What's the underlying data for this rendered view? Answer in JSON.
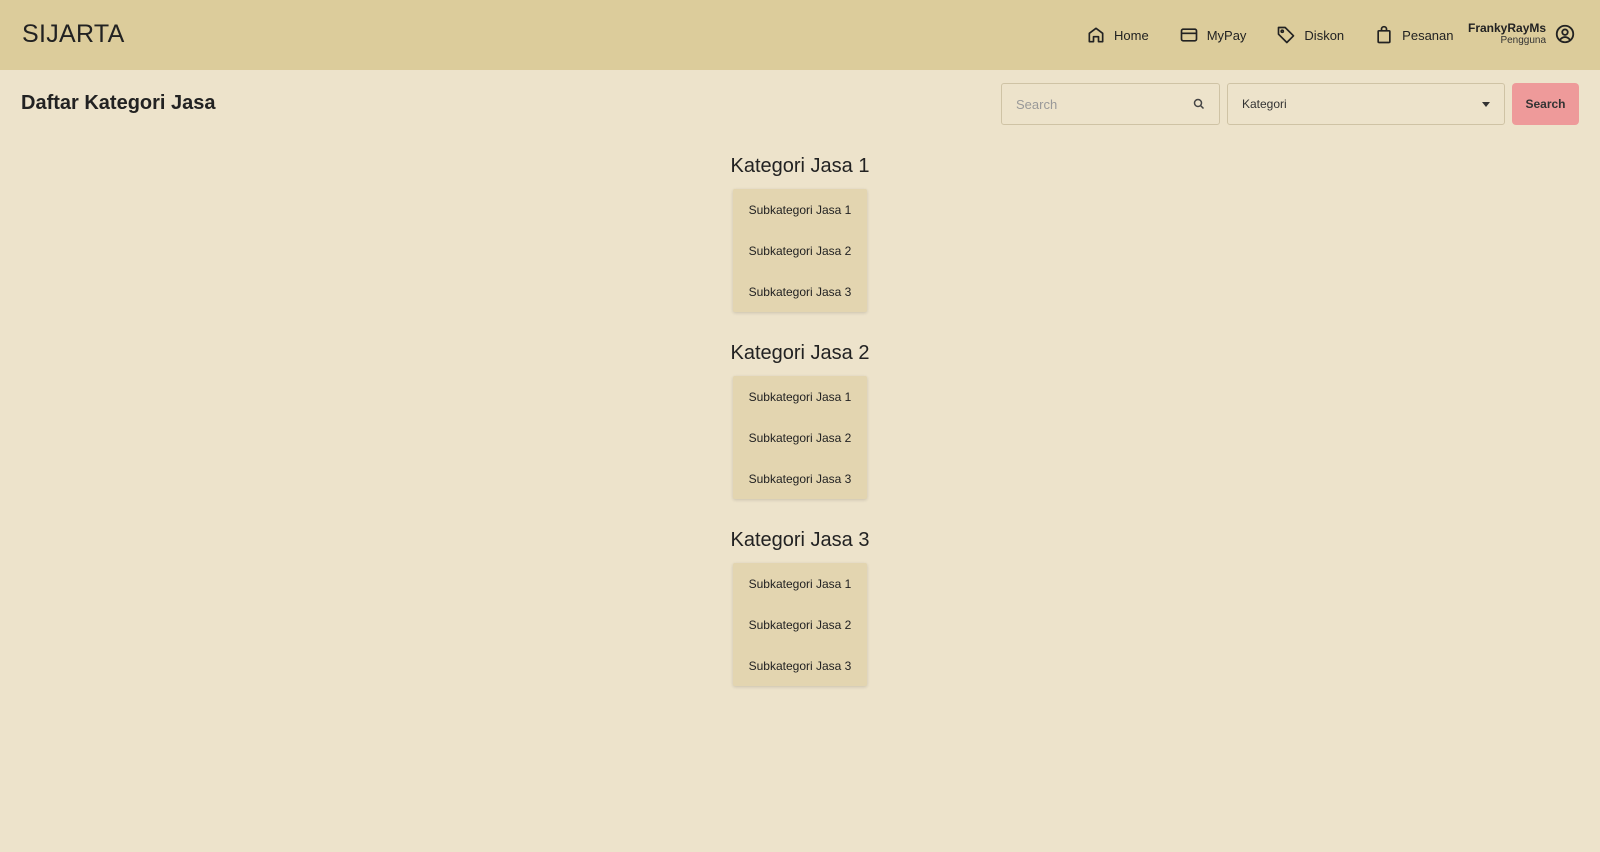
{
  "brand": "SIJARTA",
  "nav": {
    "items": [
      {
        "label": "Home",
        "icon": "home-icon"
      },
      {
        "label": "MyPay",
        "icon": "card-icon"
      },
      {
        "label": "Diskon",
        "icon": "tag-icon"
      },
      {
        "label": "Pesanan",
        "icon": "bag-icon"
      }
    ],
    "user": {
      "name": "FrankyRayMs",
      "role": "Pengguna",
      "icon": "user-circle-icon"
    }
  },
  "page": {
    "title": "Daftar Kategori Jasa"
  },
  "filters": {
    "search_placeholder": "Search",
    "search_value": "",
    "category_selected": "Kategori",
    "search_button": "Search"
  },
  "categories": [
    {
      "title": "Kategori Jasa 1",
      "subs": [
        "Subkategori Jasa 1",
        "Subkategori Jasa 2",
        "Subkategori Jasa 3"
      ]
    },
    {
      "title": "Kategori Jasa 2",
      "subs": [
        "Subkategori Jasa 1",
        "Subkategori Jasa 2",
        "Subkategori Jasa 3"
      ]
    },
    {
      "title": "Kategori Jasa 3",
      "subs": [
        "Subkategori Jasa 1",
        "Subkategori Jasa 2",
        "Subkategori Jasa 3"
      ]
    }
  ],
  "colors": {
    "navbar": "#dccc9b",
    "background": "#ede3cb",
    "accent": "#ee9a9a",
    "subcard": "#e3d5b0"
  }
}
